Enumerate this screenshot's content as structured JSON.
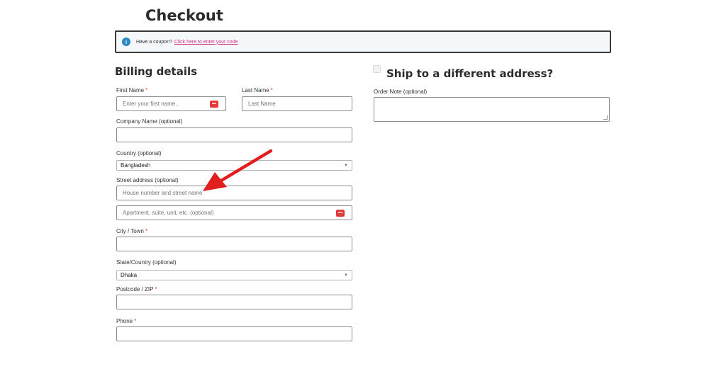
{
  "page": {
    "title": "Checkout"
  },
  "coupon": {
    "text": "Have a coupon?",
    "link": "Click here to enter your code",
    "icon": "info-icon"
  },
  "billing": {
    "title": "Billing details",
    "first_name": {
      "label": "First Name",
      "required": "*",
      "placeholder": "Enter your first name."
    },
    "last_name": {
      "label": "Last Name",
      "required": "*",
      "placeholder": "Last Name"
    },
    "company": {
      "label": "Company Name (optional)",
      "value": ""
    },
    "country": {
      "label": "Country (optional)",
      "value": "Bangladesh"
    },
    "street": {
      "label": "Street address (optional)",
      "placeholder1": "House number and street name",
      "placeholder2": "Apartment, suite, unit, etc. (optional)"
    },
    "city": {
      "label": "City / Town",
      "required": "*",
      "value": ""
    },
    "state": {
      "label": "State/Country (optional)",
      "value": "Dhaka"
    },
    "postcode": {
      "label": "Postcode / ZIP",
      "required": "*",
      "value": ""
    },
    "phone": {
      "label": "Phone",
      "required": "*",
      "value": ""
    }
  },
  "shipping": {
    "title": "Ship to a different address?",
    "order_note_label": "Order Note (optional)"
  },
  "colors": {
    "accent_link": "#d23282",
    "required": "#e2401c",
    "info_icon": "#2c88c5",
    "arrow": "#e31e1e",
    "password_icon": "#e23a3a"
  }
}
